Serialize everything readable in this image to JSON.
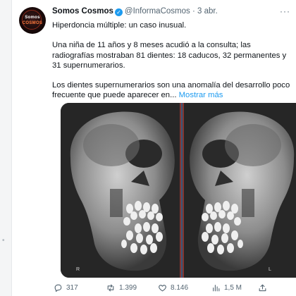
{
  "tweet": {
    "avatar": {
      "line1": "Somos",
      "line2": "COSMOS"
    },
    "author_name": "Somos Cosmos",
    "handle": "@InformaCosmos",
    "separator": "·",
    "date": "3 abr.",
    "more_label": "···",
    "text_line1": "Hiperdoncia múltiple: un caso inusual.",
    "text_para2": "Una niña de 11 años y 8 meses acudió a la consulta; las radiografías mostraban 81 dientes: 18 caducos, 32 permanentes y 31 supernumerarios.",
    "text_para3": "Los dientes supernumerarios son una anomalía del desarrollo poco frecuente que puede aparecer en...",
    "show_more": "Mostrar más",
    "image_left_label": "R",
    "image_right_label": "L"
  },
  "actions": {
    "replies": "317",
    "retweets": "1.399",
    "likes": "8.146",
    "views": "1,5 M"
  },
  "colors": {
    "accent": "#1d9bf0",
    "secondary_text": "#536471",
    "primary_text": "#0f1419"
  },
  "icons": [
    "verified-badge-icon",
    "more-icon",
    "reply-icon",
    "retweet-icon",
    "like-icon",
    "views-icon",
    "share-icon"
  ]
}
